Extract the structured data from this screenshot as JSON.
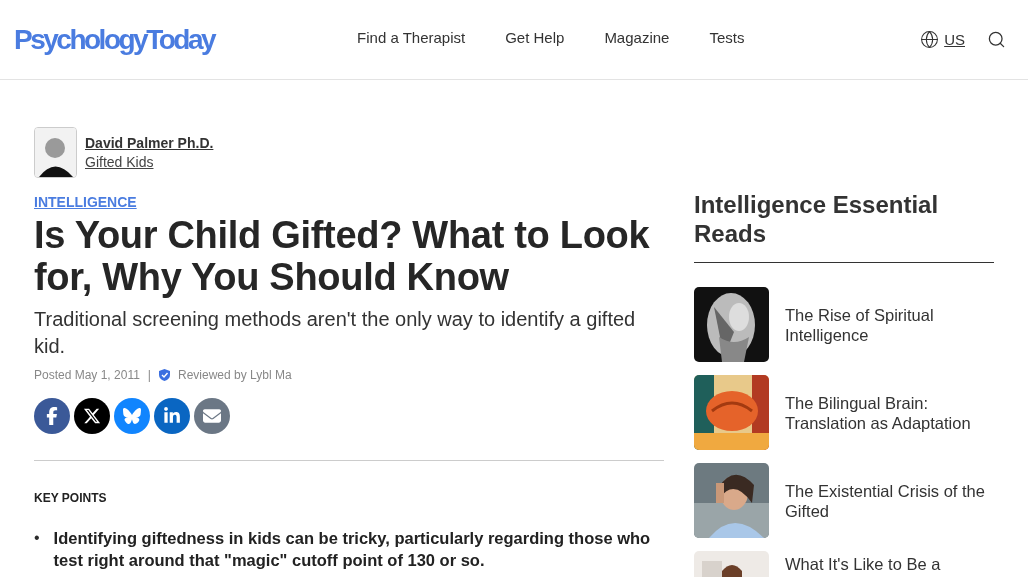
{
  "header": {
    "logo": "PsychologyToday",
    "nav": [
      {
        "label": "Find a Therapist"
      },
      {
        "label": "Get Help"
      },
      {
        "label": "Magazine"
      },
      {
        "label": "Tests"
      }
    ],
    "region": "US"
  },
  "author": {
    "name": "David Palmer Ph.D.",
    "blog": "Gifted Kids"
  },
  "article": {
    "category": "INTELLIGENCE",
    "title": "Is Your Child Gifted? What to Look for, Why You Should Know",
    "subtitle": "Traditional screening methods aren't the only way to identify a gifted kid.",
    "posted": "Posted May 1, 2011",
    "separator": "|",
    "reviewed": "Reviewed by Lybl Ma",
    "share": [
      {
        "kind": "facebook"
      },
      {
        "kind": "x"
      },
      {
        "kind": "bluesky"
      },
      {
        "kind": "linkedin"
      },
      {
        "kind": "email"
      }
    ],
    "key_points_heading": "KEY POINTS",
    "bullet": "•",
    "key_points": [
      "Identifying giftedness in kids can be tricky, particularly regarding those who test right around that \"magic\" cutoff point of 130 or so."
    ]
  },
  "sidebar": {
    "heading": "Intelligence Essential Reads",
    "items": [
      {
        "title": "The Rise of Spiritual Intelligence"
      },
      {
        "title": "The Bilingual Brain: Translation as Adaptation"
      },
      {
        "title": "The Existential Crisis of the Gifted"
      },
      {
        "title": "What It's Like to Be a"
      }
    ]
  }
}
